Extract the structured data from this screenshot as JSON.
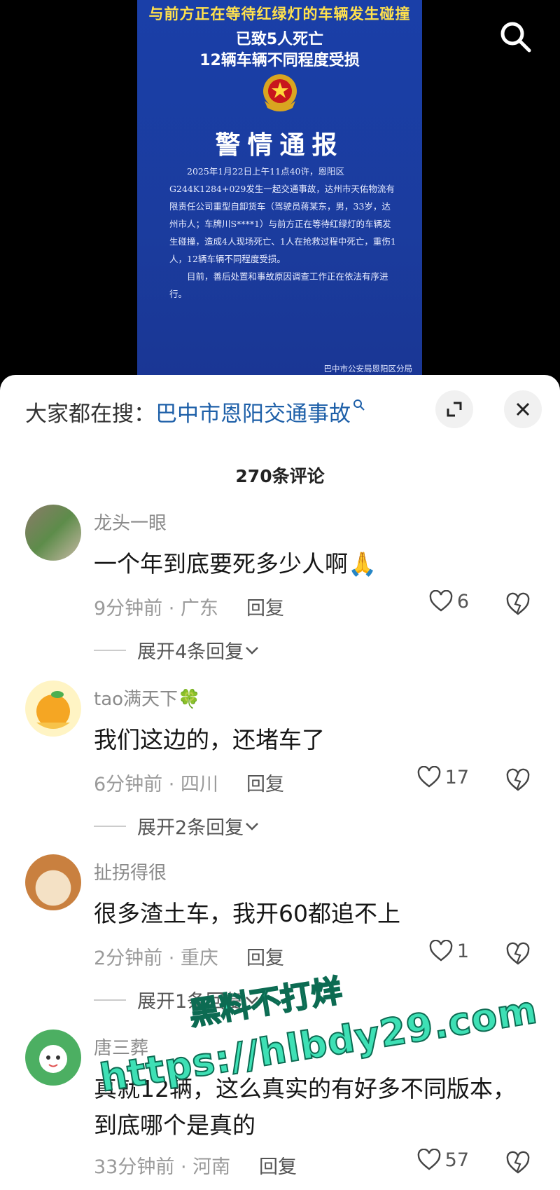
{
  "video": {
    "headline_line1": "与前方正在等待红绿灯的车辆发生碰撞",
    "headline_line2": "已致5人死亡",
    "headline_line3": "12辆车辆不同程度受损",
    "notice_title": "警情通报",
    "notice_body_1": "2025年1月22日上午11点40许，恩阳区G244K1284+029发生一起交通事故，达州市天佑物流有限责任公司重型自卸货车（驾驶员蒋某东，男，33岁，达州市人；车牌川S****1）与前方正在等待红绿灯的车辆发生碰撞，造成4人现场死亡、1人在抢救过程中死亡，重伤1人，12辆车辆不同程度受损。",
    "notice_body_2": "目前，善后处置和事故原因调查工作正在依法有序进行。",
    "notice_sign": "巴中市公安局恩阳区分局"
  },
  "sheet": {
    "search_label": "大家都在搜：",
    "search_query": "巴中市恩阳交通事故",
    "comment_count": "270条评论"
  },
  "comments": [
    {
      "user": "龙头一眼",
      "text": "一个年到底要死多少人啊🙏",
      "time_loc": "9分钟前 · 广东",
      "reply": "回复",
      "likes": "6",
      "expand": "展开4条回复"
    },
    {
      "user": "tao满天下🍀",
      "text": "我们这边的，还堵车了",
      "time_loc": "6分钟前 · 四川",
      "reply": "回复",
      "likes": "17",
      "expand": "展开2条回复"
    },
    {
      "user": "扯拐得很",
      "text": "很多渣土车，我开60都追不上",
      "time_loc": "2分钟前 · 重庆",
      "reply": "回复",
      "likes": "1",
      "expand": "展开1条回复"
    },
    {
      "user": "唐三葬",
      "text": "真就12辆，这么真实的有好多不同版本，",
      "text2": "到底哪个是真的",
      "time_loc": "33分钟前 · 河南",
      "reply": "回复",
      "likes": "57"
    }
  ],
  "watermark": {
    "line1": "黑料不打烊",
    "line2": "https://hlbdy29.com"
  },
  "colors": {
    "poster_blue": "#1b3c9e",
    "link_blue": "#1d5fa8",
    "watermark_green": "#3ee0b5"
  }
}
